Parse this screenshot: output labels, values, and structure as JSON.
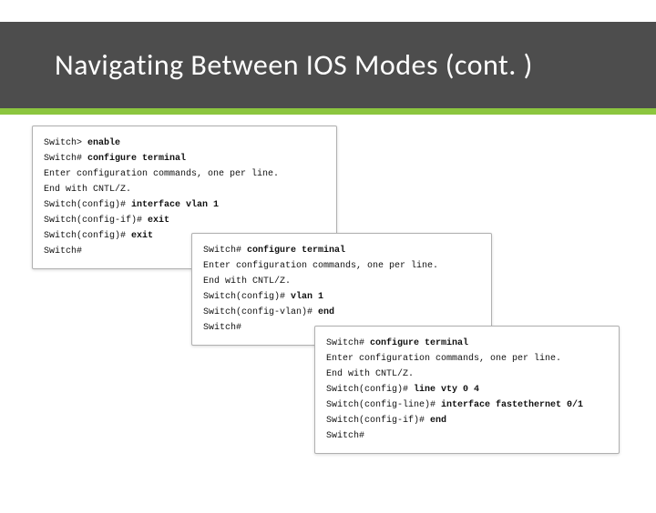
{
  "title": "Navigating Between IOS Modes (cont. )",
  "panels": {
    "p1": {
      "l1_prompt": "Switch> ",
      "l1_cmd": "enable",
      "l2_prompt": "Switch# ",
      "l2_cmd": "configure terminal",
      "l3": "Enter configuration commands, one per line.",
      "l4": "End with CNTL/Z.",
      "l5_prompt": "Switch(config)# ",
      "l5_cmd": "interface vlan 1",
      "l6_prompt": "Switch(config-if)# ",
      "l6_cmd": "exit",
      "l7_prompt": "Switch(config)# ",
      "l7_cmd": "exit",
      "l8_prompt": "Switch#"
    },
    "p2": {
      "l1_prompt": "Switch# ",
      "l1_cmd": "configure terminal",
      "l2": "Enter configuration commands, one per line.",
      "l3": "End with CNTL/Z.",
      "l4_prompt": "Switch(config)# ",
      "l4_cmd": "vlan 1",
      "l5_prompt": "Switch(config-vlan)# ",
      "l5_cmd": "end",
      "l6_prompt": "Switch#"
    },
    "p3": {
      "l1_prompt": "Switch# ",
      "l1_cmd": "configure terminal",
      "l2": "Enter configuration commands, one per line.",
      "l3": "End with CNTL/Z.",
      "l4_prompt": "Switch(config)# ",
      "l4_cmd": "line vty 0 4",
      "l5_prompt": "Switch(config-line)# ",
      "l5_cmd": "interface fastethernet 0/1",
      "l6_prompt": "Switch(config-if)# ",
      "l6_cmd": "end",
      "l7_prompt": "Switch#"
    }
  }
}
